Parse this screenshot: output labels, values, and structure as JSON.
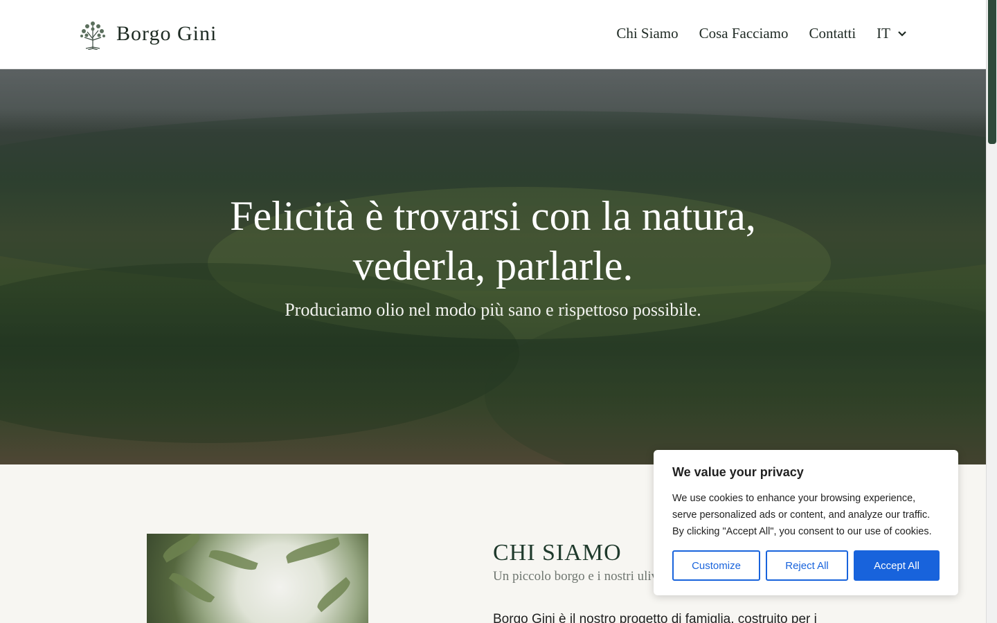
{
  "header": {
    "brand": "Borgo Gini",
    "logo_icon": "olive-tree-icon",
    "nav": [
      {
        "label": "Chi Siamo"
      },
      {
        "label": "Cosa Facciamo"
      },
      {
        "label": "Contatti"
      }
    ],
    "language": {
      "label": "IT",
      "icon": "chevron-down-icon"
    }
  },
  "hero": {
    "title_line1": "Felicità è trovarsi con la natura,",
    "title_line2": "vederla, parlarle.",
    "subtitle": "Produciamo olio nel modo più sano e rispettoso possibile."
  },
  "about": {
    "title": "CHI SIAMO",
    "subtitle": "Un piccolo borgo e i nostri uliv",
    "body": "Borgo Gini è il nostro progetto di famiglia, costruito per i"
  },
  "cookie_banner": {
    "title": "We value your privacy",
    "text": "We use cookies to enhance your browsing experience, serve personalized ads or content, and analyze our traffic. By clicking \"Accept All\", you consent to our use of cookies.",
    "customize_label": "Customize",
    "reject_label": "Reject All",
    "accept_label": "Accept All"
  },
  "colors": {
    "brand_green": "#1f3a2c",
    "cookie_accent": "#1863dc",
    "background": "#f7f6f2"
  }
}
